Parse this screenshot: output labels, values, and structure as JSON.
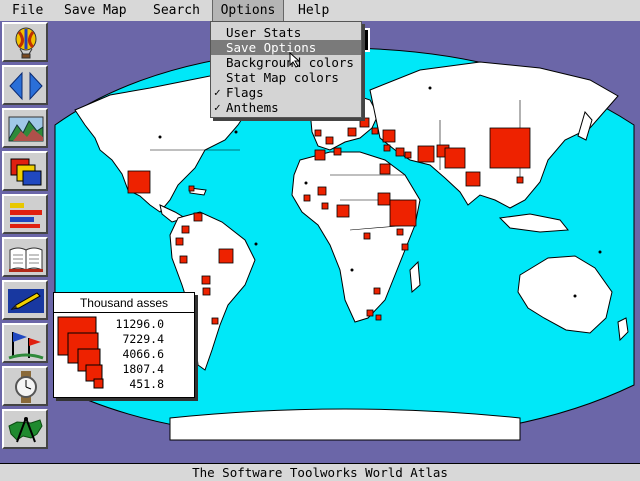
{
  "menubar": {
    "items": [
      "File",
      "Save Map",
      "Search",
      "Options",
      "Help"
    ],
    "open_menu": "Options"
  },
  "options_menu": {
    "items": [
      {
        "label": "User Stats",
        "checked": false,
        "selected": false
      },
      {
        "label": "Save Options",
        "checked": false,
        "selected": true
      },
      {
        "label": "Background colors",
        "checked": false,
        "selected": false
      },
      {
        "label": "Stat Map colors",
        "checked": false,
        "selected": false
      },
      {
        "label": "Flags",
        "checked": true,
        "selected": false
      },
      {
        "label": "Anthems",
        "checked": true,
        "selected": false
      }
    ]
  },
  "toolbar": {
    "buttons": [
      "balloon-icon",
      "left-right-arrows-icon",
      "landscape-icon",
      "stacked-squares-icon",
      "bar-stats-icon",
      "book-icon",
      "pencil-icon",
      "flags-icon",
      "wristwatch-icon",
      "usa-compass-icon"
    ]
  },
  "legend": {
    "title": "Thousand asses",
    "values": [
      "11296.0",
      "7229.4",
      "4066.6",
      "1807.4",
      "451.8"
    ]
  },
  "status_bar": {
    "text": "The Software Toolworks World Atlas"
  },
  "colors": {
    "background": "#6b66a8",
    "ocean": "#00e8f8",
    "land": "#ffffff",
    "stat_square": "#ee2200",
    "menu": "#d8d8d8"
  }
}
